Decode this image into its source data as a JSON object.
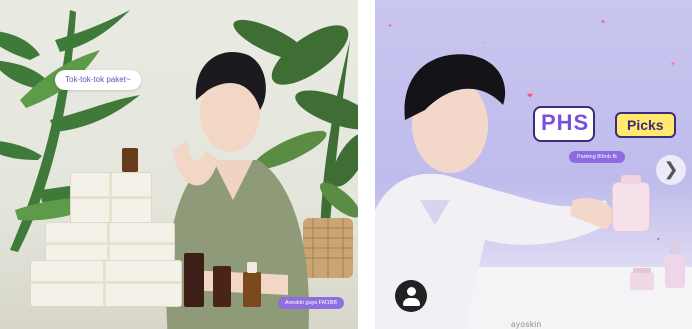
{
  "left_post": {
    "speech_bubble": "Tok-tok-tok paket~",
    "caption_pill": "Aveskin guys FM1BB",
    "colors": {
      "bubble_text": "#6a4fc0",
      "pill_bg": "#8f6fe0"
    }
  },
  "right_post": {
    "title_main": "PHS",
    "title_tag": "Picks",
    "sub_pill": "Parking 80mb fit",
    "next_icon": "chevron-right-icon",
    "next_glyph": "❯",
    "account_icon": "user-account-icon",
    "brand_label": "ayoskin",
    "colors": {
      "badge_purple": "#7a4fe0",
      "tag_yellow": "#ffe96e",
      "pill_bg": "#8d6be0"
    }
  }
}
